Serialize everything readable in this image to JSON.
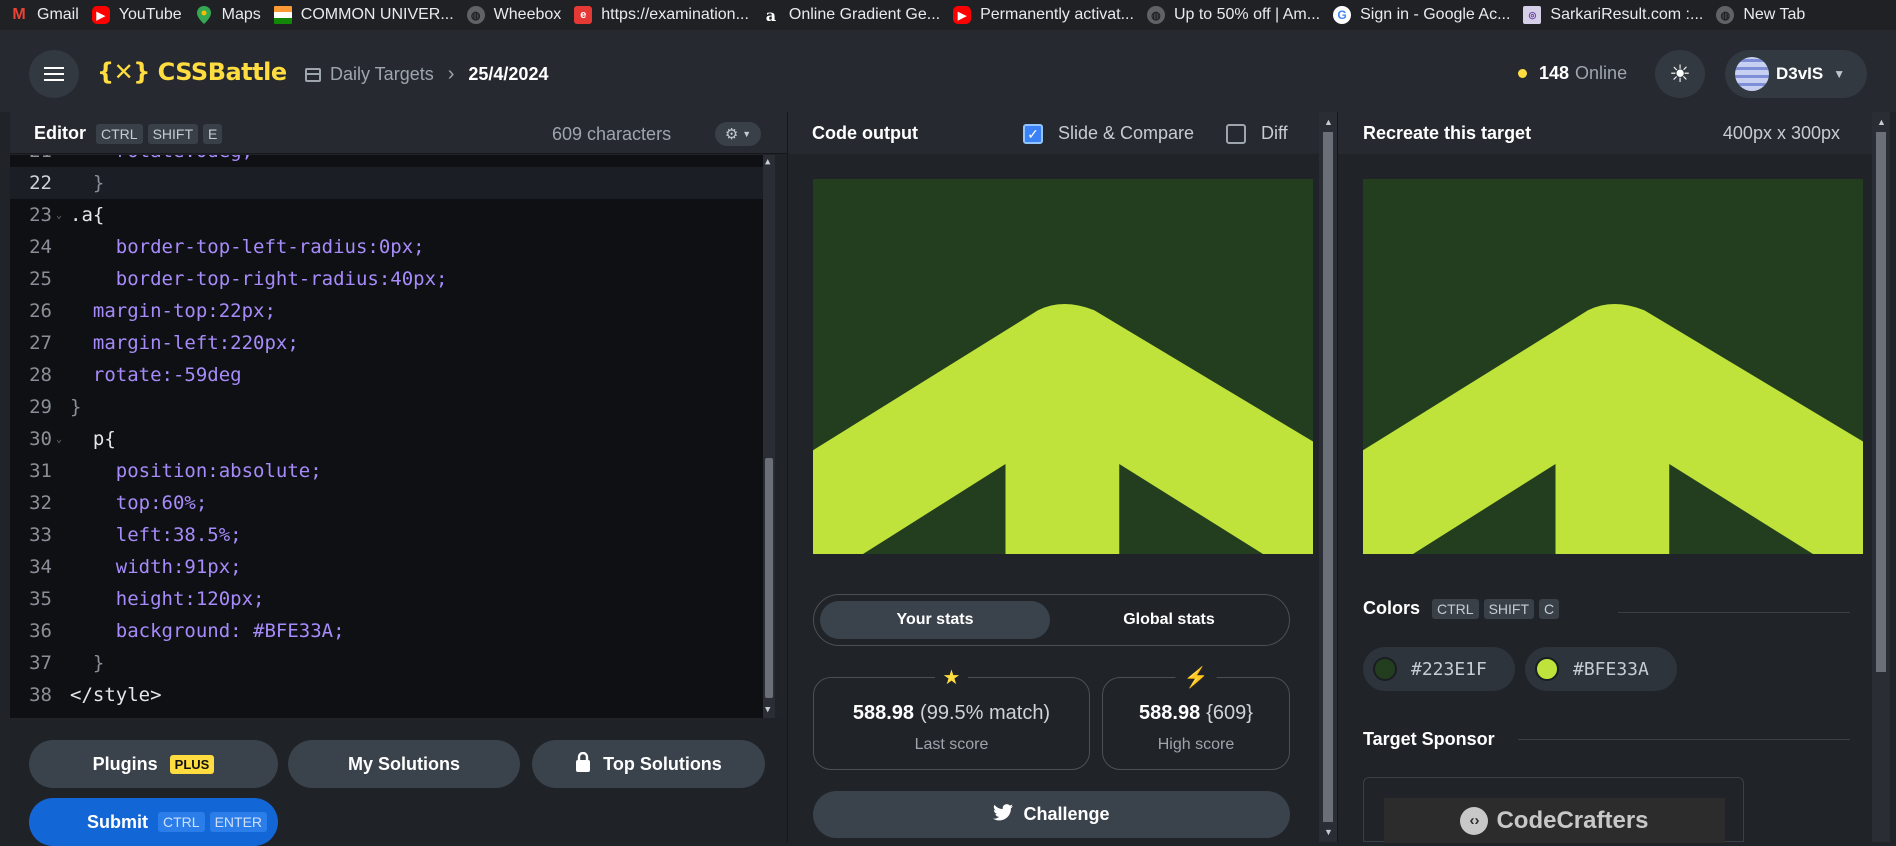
{
  "bookmarks": [
    {
      "label": "Gmail",
      "icon": "gmail-icon"
    },
    {
      "label": "YouTube",
      "icon": "youtube-icon"
    },
    {
      "label": "Maps",
      "icon": "maps-icon"
    },
    {
      "label": "COMMON UNIVER...",
      "icon": "india-flag-icon"
    },
    {
      "label": "Wheebox",
      "icon": "globe-icon"
    },
    {
      "label": "https://examination...",
      "icon": "exam-icon"
    },
    {
      "label": "Online Gradient Ge...",
      "icon": "amazon-a-icon"
    },
    {
      "label": "Permanently activat...",
      "icon": "youtube-icon"
    },
    {
      "label": "Up to 50% off | Am...",
      "icon": "globe-icon"
    },
    {
      "label": "Sign in - Google Ac...",
      "icon": "google-icon"
    },
    {
      "label": "SarkariResult.com :...",
      "icon": "sarkari-icon"
    },
    {
      "label": "New Tab",
      "icon": "globe-icon"
    }
  ],
  "nav": {
    "logo": "{✕} CSSBattle",
    "crumb_section": "Daily Targets",
    "crumb_date": "25/4/2024",
    "online_count": "148",
    "online_label": "Online",
    "username": "D3vIS"
  },
  "editor": {
    "title": "Editor",
    "shortcut": [
      "CTRL",
      "SHIFT",
      "E"
    ],
    "char_count": "609 characters",
    "lines": [
      {
        "n": "22",
        "text": "  }"
      },
      {
        "n": "23",
        "text": ".a{"
      },
      {
        "n": "24",
        "text": "    border-top-left-radius:0px;"
      },
      {
        "n": "25",
        "text": "    border-top-right-radius:40px;"
      },
      {
        "n": "26",
        "text": "  margin-top:22px;"
      },
      {
        "n": "27",
        "text": "  margin-left:220px;"
      },
      {
        "n": "28",
        "text": "  rotate:-59deg"
      },
      {
        "n": "29",
        "text": "}"
      },
      {
        "n": "30",
        "text": "  p{"
      },
      {
        "n": "31",
        "text": "    position:absolute;"
      },
      {
        "n": "32",
        "text": "    top:60%;"
      },
      {
        "n": "33",
        "text": "    left:38.5%;"
      },
      {
        "n": "34",
        "text": "    width:91px;"
      },
      {
        "n": "35",
        "text": "    height:120px;"
      },
      {
        "n": "36",
        "text": "    background: #BFE33A;"
      },
      {
        "n": "37",
        "text": "  }"
      },
      {
        "n": "38",
        "text": "</style>"
      }
    ],
    "buttons": {
      "plugins": "Plugins",
      "plus_badge": "PLUS",
      "my_solutions": "My Solutions",
      "top_solutions": "Top Solutions",
      "submit": "Submit",
      "submit_shortcut": [
        "CTRL",
        "ENTER"
      ]
    }
  },
  "output": {
    "title": "Code output",
    "slide_compare_label": "Slide & Compare",
    "slide_compare_checked": true,
    "diff_label": "Diff",
    "diff_checked": false,
    "tabs": [
      "Your stats",
      "Global stats"
    ],
    "active_tab": "Your stats",
    "last_score": {
      "value": "588.98",
      "detail": "(99.5% match)",
      "label": "Last score"
    },
    "high_score": {
      "value": "588.98",
      "detail": "{609}",
      "label": "High score"
    },
    "challenge_label": "Challenge"
  },
  "target": {
    "title": "Recreate this target",
    "size": "400px x 300px",
    "colors_title": "Colors",
    "colors_shortcut": [
      "CTRL",
      "SHIFT",
      "C"
    ],
    "colors": [
      {
        "hex": "#223E1F"
      },
      {
        "hex": "#BFE33A"
      }
    ],
    "sponsor_title": "Target Sponsor",
    "sponsor_name": "CodeCrafters"
  },
  "palette": {
    "bg_dark_green": "#223E1F",
    "lime": "#BFE33A",
    "accent_yellow": "#FFDD40",
    "submit_blue": "#1366D6"
  }
}
